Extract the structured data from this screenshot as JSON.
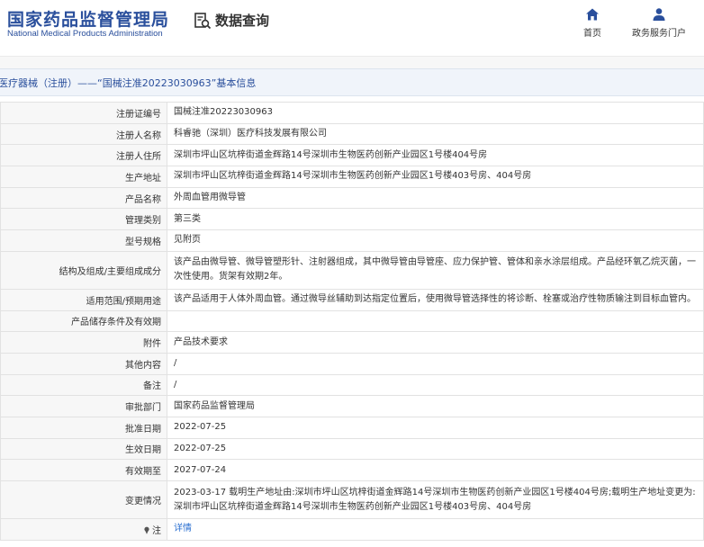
{
  "header": {
    "logo_cn": "国家药品监督管理局",
    "logo_en": "National Medical Products Administration",
    "query_label": "数据查询",
    "nav_home": "首页",
    "nav_gov": "政务服务门户"
  },
  "breadcrumb": "医疗器械（注册）——“国械注准20223030963”基本信息",
  "rows": [
    {
      "label": "注册证编号",
      "value": "国械注准20223030963"
    },
    {
      "label": "注册人名称",
      "value": "科睿驰（深圳）医疗科技发展有限公司"
    },
    {
      "label": "注册人住所",
      "value": "深圳市坪山区坑梓街道金辉路14号深圳市生物医药创新产业园区1号楼404号房"
    },
    {
      "label": "生产地址",
      "value": "深圳市坪山区坑梓街道金辉路14号深圳市生物医药创新产业园区1号楼403号房、404号房"
    },
    {
      "label": "产品名称",
      "value": "外周血管用微导管"
    },
    {
      "label": "管理类别",
      "value": "第三类"
    },
    {
      "label": "型号规格",
      "value": "见附页"
    },
    {
      "label": "结构及组成/主要组成成分",
      "value": "该产品由微导管、微导管塑形针、注射器组成，其中微导管由导管座、应力保护管、管体和亲水涂层组成。产品经环氧乙烷灭菌，一次性使用。货架有效期2年。"
    },
    {
      "label": "适用范围/预期用途",
      "value": "该产品适用于人体外周血管。通过微导丝辅助到达指定位置后，使用微导管选择性的将诊断、栓塞或治疗性物质输注到目标血管内。"
    },
    {
      "label": "产品储存条件及有效期",
      "value": ""
    },
    {
      "label": "附件",
      "value": "产品技术要求"
    },
    {
      "label": "其他内容",
      "value": "/"
    },
    {
      "label": "备注",
      "value": "/"
    },
    {
      "label": "审批部门",
      "value": "国家药品监督管理局"
    },
    {
      "label": "批准日期",
      "value": "2022-07-25"
    },
    {
      "label": "生效日期",
      "value": "2022-07-25"
    },
    {
      "label": "有效期至",
      "value": "2027-07-24"
    },
    {
      "label": "变更情况",
      "value": "2023-03-17 载明生产地址由:深圳市坪山区坑梓街道金辉路14号深圳市生物医药创新产业园区1号楼404号房;载明生产地址变更为:深圳市坪山区坑梓街道金辉路14号深圳市生物医药创新产业园区1号楼403号房、404号房"
    }
  ],
  "note": {
    "label": "注",
    "value": "详情"
  },
  "colors": {
    "brand": "#2a4f9c",
    "link": "#2a6fd0"
  }
}
